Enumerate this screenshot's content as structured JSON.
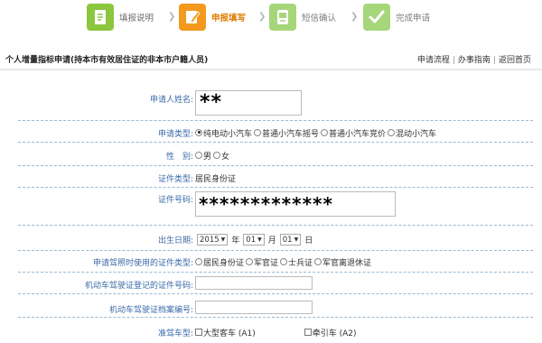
{
  "steps": [
    {
      "label": "填报说明",
      "state": "done",
      "icon": "document-icon"
    },
    {
      "label": "申报填写",
      "state": "active",
      "icon": "edit-icon"
    },
    {
      "label": "短信确认",
      "state": "todo",
      "icon": "message-icon"
    },
    {
      "label": "完成申请",
      "state": "todo",
      "icon": "check-icon"
    }
  ],
  "colors": {
    "done": "#8cc63f",
    "active": "#f39a1e",
    "todo": "#a6d67a",
    "label_blue": "#3a6aa8"
  },
  "header": {
    "title": "个人增量指标申请(持本市有效居住证的非本市户籍人员)",
    "links": [
      "申请流程",
      "办事指南",
      "返回首页"
    ]
  },
  "form": {
    "name": {
      "label": "申请人姓名:",
      "value": "**"
    },
    "apply_type": {
      "label": "申请类型:",
      "options": [
        "纯电动小汽车",
        "普通小汽车摇号",
        "普通小汽车竞价",
        "混动小汽车"
      ],
      "selected": 0
    },
    "sex": {
      "label": "性　别:",
      "options": [
        "男",
        "女"
      ]
    },
    "cert_type": {
      "label": "证件类型:",
      "value": "居民身份证"
    },
    "cert_no": {
      "label": "证件号码:",
      "value": "*************"
    },
    "birth": {
      "label": "出生日期:",
      "year": "2015",
      "year_unit": "年",
      "month": "01",
      "month_unit": "月",
      "day": "01",
      "day_unit": "日"
    },
    "doc_type": {
      "label": "申请驾照时使用的证件类型:",
      "options": [
        "居民身份证",
        "军官证",
        "士兵证",
        "军官离退休证"
      ]
    },
    "license_cert": {
      "label": "机动车驾驶证登记的证件号码:",
      "value": ""
    },
    "license_file": {
      "label": "机动车驾驶证档案编号:",
      "value": ""
    },
    "drive_type": {
      "label": "准驾车型:",
      "options": [
        "大型客车 (A1)",
        "牵引车 (A2)"
      ]
    }
  }
}
